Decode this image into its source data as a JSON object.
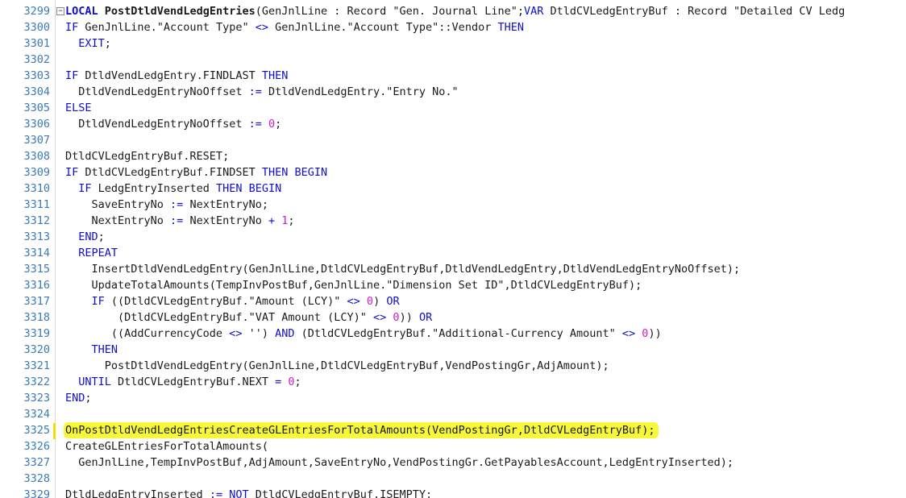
{
  "editor": {
    "highlight_color": "#f8f83a",
    "keyword_color": "#1010c8",
    "number_color": "#d01cc8",
    "line_number_color": "#3b7ab8",
    "lines": [
      {
        "n": "3299",
        "c": "LOCAL PostDtldVendLedgEntries(GenJnlLine : Record \"Gen. Journal Line\";VAR DtldCVLedgEntryBuf : Record \"Detailed CV Ledg"
      },
      {
        "n": "3300",
        "c": "IF GenJnlLine.\"Account Type\" <> GenJnlLine.\"Account Type\"::Vendor THEN"
      },
      {
        "n": "3301",
        "c": "  EXIT;"
      },
      {
        "n": "3302",
        "c": ""
      },
      {
        "n": "3303",
        "c": "IF DtldVendLedgEntry.FINDLAST THEN"
      },
      {
        "n": "3304",
        "c": "  DtldVendLedgEntryNoOffset := DtldVendLedgEntry.\"Entry No.\""
      },
      {
        "n": "3305",
        "c": "ELSE"
      },
      {
        "n": "3306",
        "c": "  DtldVendLedgEntryNoOffset := 0;"
      },
      {
        "n": "3307",
        "c": ""
      },
      {
        "n": "3308",
        "c": "DtldCVLedgEntryBuf.RESET;"
      },
      {
        "n": "3309",
        "c": "IF DtldCVLedgEntryBuf.FINDSET THEN BEGIN"
      },
      {
        "n": "3310",
        "c": "  IF LedgEntryInserted THEN BEGIN"
      },
      {
        "n": "3311",
        "c": "    SaveEntryNo := NextEntryNo;"
      },
      {
        "n": "3312",
        "c": "    NextEntryNo := NextEntryNo + 1;"
      },
      {
        "n": "3313",
        "c": "  END;"
      },
      {
        "n": "3314",
        "c": "  REPEAT"
      },
      {
        "n": "3315",
        "c": "    InsertDtldVendLedgEntry(GenJnlLine,DtldCVLedgEntryBuf,DtldVendLedgEntry,DtldVendLedgEntryNoOffset);"
      },
      {
        "n": "3316",
        "c": "    UpdateTotalAmounts(TempInvPostBuf,GenJnlLine.\"Dimension Set ID\",DtldCVLedgEntryBuf);"
      },
      {
        "n": "3317",
        "c": "    IF ((DtldCVLedgEntryBuf.\"Amount (LCY)\" <> 0) OR"
      },
      {
        "n": "3318",
        "c": "        (DtldCVLedgEntryBuf.\"VAT Amount (LCY)\" <> 0)) OR"
      },
      {
        "n": "3319",
        "c": "       ((AddCurrencyCode <> '') AND (DtldCVLedgEntryBuf.\"Additional-Currency Amount\" <> 0))"
      },
      {
        "n": "3320",
        "c": "    THEN"
      },
      {
        "n": "3321",
        "c": "      PostDtldVendLedgEntry(GenJnlLine,DtldCVLedgEntryBuf,VendPostingGr,AdjAmount);"
      },
      {
        "n": "3322",
        "c": "  UNTIL DtldCVLedgEntryBuf.NEXT = 0;"
      },
      {
        "n": "3323",
        "c": "END;"
      },
      {
        "n": "3324",
        "c": ""
      },
      {
        "n": "3325",
        "c": "OnPostDtldVendLedgEntriesCreateGLEntriesForTotalAmounts(VendPostingGr,DtldCVLedgEntryBuf);"
      },
      {
        "n": "3326",
        "c": "CreateGLEntriesForTotalAmounts("
      },
      {
        "n": "3327",
        "c": "  GenJnlLine,TempInvPostBuf,AdjAmount,SaveEntryNo,VendPostingGr.GetPayablesAccount,LedgEntryInserted);"
      },
      {
        "n": "3328",
        "c": ""
      },
      {
        "n": "3329",
        "c": "DtldLedgEntryInserted := NOT DtldCVLedgEntryBuf.ISEMPTY;"
      }
    ],
    "highlighted_line": "3325",
    "fold_marker": "⊟"
  }
}
